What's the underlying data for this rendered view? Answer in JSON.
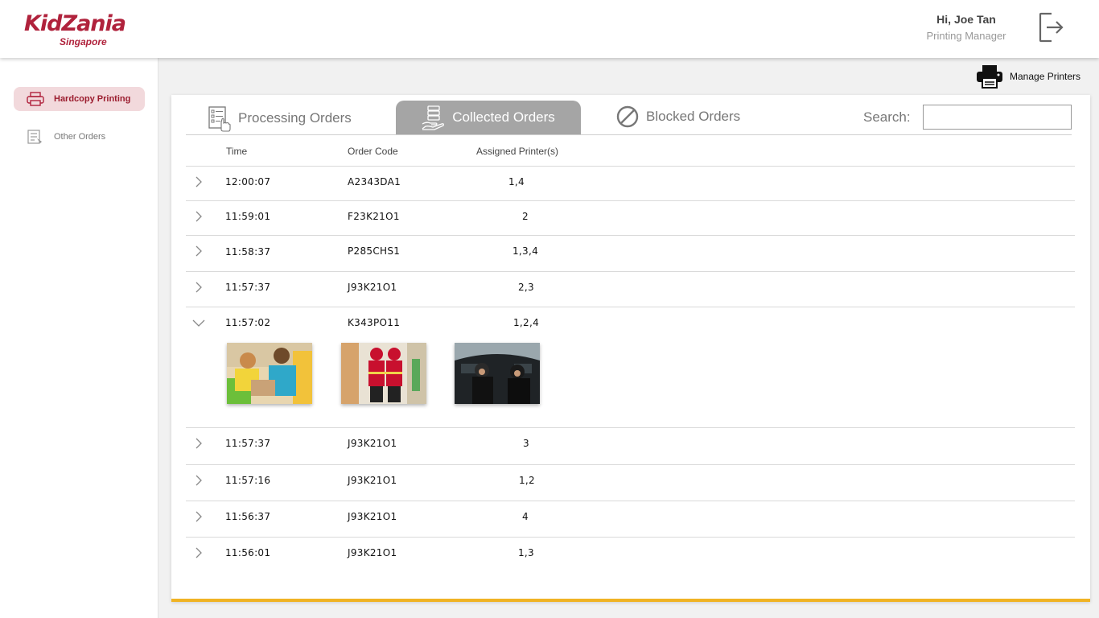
{
  "brand": {
    "name": "KidZania",
    "location": "Singapore"
  },
  "user": {
    "greeting": "Hi, Joe Tan",
    "role": "Printing Manager"
  },
  "sidebar": {
    "items": [
      {
        "label": "Hardcopy Printing",
        "icon": "printer-icon",
        "active": true
      },
      {
        "label": "Other Orders",
        "icon": "list-icon",
        "active": false
      }
    ]
  },
  "toolbar": {
    "manage_printers": "Manage Printers"
  },
  "tabs": [
    {
      "label": "Processing Orders",
      "icon": "checklist-icon",
      "active": false
    },
    {
      "label": "Collected Orders",
      "icon": "hand-tray-icon",
      "active": true
    },
    {
      "label": "Blocked Orders",
      "icon": "blocked-icon",
      "active": false
    }
  ],
  "search": {
    "label": "Search:",
    "value": ""
  },
  "table": {
    "headers": [
      "Time",
      "Order Code",
      "Assigned Printer(s)"
    ],
    "rows": [
      {
        "time": "12:00:07",
        "code": "A2343DA1",
        "printers": "1,4",
        "expanded": false
      },
      {
        "time": "11:59:01",
        "code": "F23K21O1",
        "printers": "2",
        "expanded": false
      },
      {
        "time": "11:58:37",
        "code": "P285CHS1",
        "printers": "1,3,4",
        "expanded": false
      },
      {
        "time": "11:57:37",
        "code": "J93K21O1",
        "printers": "2,3",
        "expanded": false
      },
      {
        "time": "11:57:02",
        "code": "K343PO11",
        "printers": "1,2,4",
        "expanded": true
      },
      {
        "time": "11:57:37",
        "code": "J93K21O1",
        "printers": "3",
        "expanded": false
      },
      {
        "time": "11:57:16",
        "code": "J93K21O1",
        "printers": "1,2",
        "expanded": false
      },
      {
        "time": "11:56:37",
        "code": "J93K21O1",
        "printers": "4",
        "expanded": false
      },
      {
        "time": "11:56:01",
        "code": "J93K21O1",
        "printers": "1,3",
        "expanded": false
      }
    ]
  },
  "colors": {
    "brand": "#b0223c",
    "active_tab": "#a5a5a5",
    "accent_bar": "#f0b323",
    "active_nav_bg": "#f2d9dc"
  }
}
